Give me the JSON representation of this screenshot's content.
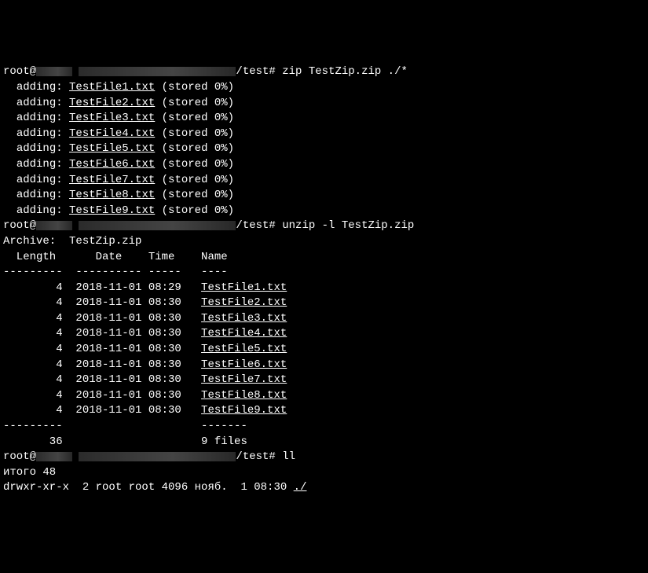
{
  "prompt1": {
    "user": "root@",
    "path": "/test#",
    "command": "zip TestZip.zip ./*"
  },
  "adding": [
    {
      "label": "adding:",
      "file": "TestFile1.txt",
      "status": "(stored 0%)"
    },
    {
      "label": "adding:",
      "file": "TestFile2.txt",
      "status": "(stored 0%)"
    },
    {
      "label": "adding:",
      "file": "TestFile3.txt",
      "status": "(stored 0%)"
    },
    {
      "label": "adding:",
      "file": "TestFile4.txt",
      "status": "(stored 0%)"
    },
    {
      "label": "adding:",
      "file": "TestFile5.txt",
      "status": "(stored 0%)"
    },
    {
      "label": "adding:",
      "file": "TestFile6.txt",
      "status": "(stored 0%)"
    },
    {
      "label": "adding:",
      "file": "TestFile7.txt",
      "status": "(stored 0%)"
    },
    {
      "label": "adding:",
      "file": "TestFile8.txt",
      "status": "(stored 0%)"
    },
    {
      "label": "adding:",
      "file": "TestFile9.txt",
      "status": "(stored 0%)"
    }
  ],
  "prompt2": {
    "user": "root@",
    "path": "/test#",
    "command": "unzip -l TestZip.zip"
  },
  "archiveLine": "Archive:  TestZip.zip",
  "header": "  Length      Date    Time    Name",
  "hsep": "---------  ---------- -----   ----",
  "listing": [
    {
      "len": "4",
      "date": "2018-11-01",
      "time": "08:29",
      "name": "TestFile1.txt"
    },
    {
      "len": "4",
      "date": "2018-11-01",
      "time": "08:30",
      "name": "TestFile2.txt"
    },
    {
      "len": "4",
      "date": "2018-11-01",
      "time": "08:30",
      "name": "TestFile3.txt"
    },
    {
      "len": "4",
      "date": "2018-11-01",
      "time": "08:30",
      "name": "TestFile4.txt"
    },
    {
      "len": "4",
      "date": "2018-11-01",
      "time": "08:30",
      "name": "TestFile5.txt"
    },
    {
      "len": "4",
      "date": "2018-11-01",
      "time": "08:30",
      "name": "TestFile6.txt"
    },
    {
      "len": "4",
      "date": "2018-11-01",
      "time": "08:30",
      "name": "TestFile7.txt"
    },
    {
      "len": "4",
      "date": "2018-11-01",
      "time": "08:30",
      "name": "TestFile8.txt"
    },
    {
      "len": "4",
      "date": "2018-11-01",
      "time": "08:30",
      "name": "TestFile9.txt"
    }
  ],
  "fsep": "---------                     -------",
  "footer": {
    "total": "36",
    "files": "9 files"
  },
  "prompt3": {
    "user": "root@",
    "path": "/test#",
    "command": "ll"
  },
  "llTotal": "итого 48",
  "llRow": {
    "perm": "drwxr-xr-x",
    "links": "2",
    "owner": "root",
    "group": "root",
    "size": "4096",
    "month": "нояб.",
    "day": "1",
    "time": "08:30",
    "name": "./"
  }
}
